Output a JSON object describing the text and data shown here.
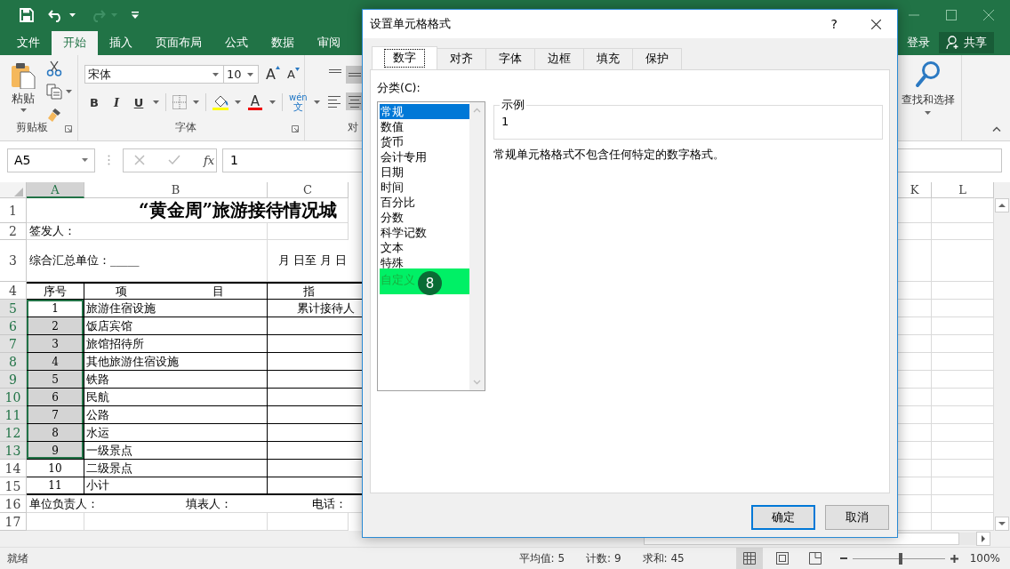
{
  "title_bar": {
    "quick_access": [
      {
        "kind": "save",
        "disabled": false
      },
      {
        "kind": "undo",
        "disabled": false
      },
      {
        "kind": "redo",
        "disabled": true
      },
      {
        "kind": "customize",
        "disabled": false
      }
    ]
  },
  "ribbon_tabs": [
    {
      "label": "文件",
      "selected": false
    },
    {
      "label": "开始",
      "selected": true
    },
    {
      "label": "插入",
      "selected": false
    },
    {
      "label": "页面布局",
      "selected": false
    },
    {
      "label": "公式",
      "selected": false
    },
    {
      "label": "数据",
      "selected": false
    },
    {
      "label": "审阅",
      "selected": false
    }
  ],
  "account": {
    "sign_in": "登录",
    "share": "共享"
  },
  "ribbon": {
    "clipboard": {
      "paste": "粘贴",
      "label": "剪贴板"
    },
    "font": {
      "name": "宋体",
      "size": "10",
      "grow": "A",
      "shrink": "A",
      "bold": "B",
      "italic": "I",
      "underline": "U",
      "font_color": "A",
      "phonetic": "wén",
      "phonetic_char": "文",
      "label": "字体"
    },
    "alignment": {
      "label": "对",
      "vertical": [
        {
          "kind": "top",
          "selected": false
        },
        {
          "kind": "middle",
          "selected": true
        }
      ],
      "horizontal": [
        {
          "kind": "left",
          "selected": false
        },
        {
          "kind": "center",
          "selected": true
        }
      ]
    },
    "editing": {
      "find_select": "查找和选择"
    }
  },
  "formula_bar": {
    "name_box": "A5",
    "function_label": "fx",
    "value": "1"
  },
  "sheet": {
    "columns": [
      {
        "label": "A",
        "selected": true
      },
      {
        "label": "B",
        "selected": false
      },
      {
        "label": "C",
        "selected": false
      },
      {
        "label": "K",
        "selected": false
      },
      {
        "label": "L",
        "selected": false
      }
    ],
    "rows": [
      {
        "number": "1",
        "kind": "title",
        "selected": false,
        "title": "“黄金周”旅游接待情况城"
      },
      {
        "number": "2",
        "kind": "plain",
        "selected": false,
        "text": "签发人："
      },
      {
        "number": "3",
        "kind": "unit",
        "selected": false,
        "text": "综合汇总单位：_____",
        "date_range": "月 日至 月 日"
      },
      {
        "number": "4",
        "kind": "header",
        "selected": false,
        "index": "序号",
        "item_left": "项",
        "item_right": "目",
        "indicator": "指"
      },
      {
        "number": "5",
        "kind": "data",
        "selected": true,
        "index": "1",
        "item": "旅游住宿设施",
        "indicator": "累计接待人"
      },
      {
        "number": "6",
        "kind": "data",
        "selected": true,
        "index": "2",
        "item": "饭店宾馆"
      },
      {
        "number": "7",
        "kind": "data",
        "selected": true,
        "index": "3",
        "item": "旅馆招待所"
      },
      {
        "number": "8",
        "kind": "data",
        "selected": true,
        "index": "4",
        "item": "其他旅游住宿设施"
      },
      {
        "number": "9",
        "kind": "data",
        "selected": true,
        "index": "5",
        "item": "铁路"
      },
      {
        "number": "10",
        "kind": "data",
        "selected": true,
        "index": "6",
        "item": "民航"
      },
      {
        "number": "11",
        "kind": "data",
        "selected": true,
        "index": "7",
        "item": "公路"
      },
      {
        "number": "12",
        "kind": "data",
        "selected": true,
        "index": "8",
        "item": "水运"
      },
      {
        "number": "13",
        "kind": "data",
        "selected": true,
        "index": "9",
        "item": "一级景点"
      },
      {
        "number": "14",
        "kind": "data",
        "selected": false,
        "index": "10",
        "item": "二级景点"
      },
      {
        "number": "15",
        "kind": "data",
        "selected": false,
        "index": "11",
        "item": "小计"
      },
      {
        "number": "16",
        "kind": "footer",
        "selected": false,
        "texts": [
          "单位负责人：",
          "填表人：",
          "电话："
        ]
      },
      {
        "number": "17",
        "kind": "blank",
        "selected": false
      }
    ]
  },
  "dialog": {
    "title": "设置单元格格式",
    "help": "?",
    "tabs": [
      {
        "label": "数字",
        "selected": true
      },
      {
        "label": "对齐",
        "selected": false
      },
      {
        "label": "字体",
        "selected": false
      },
      {
        "label": "边框",
        "selected": false
      },
      {
        "label": "填充",
        "selected": false
      },
      {
        "label": "保护",
        "selected": false
      }
    ],
    "category_label": "分类(C):",
    "categories": [
      {
        "label": "常规",
        "selected": true,
        "highlighted": false
      },
      {
        "label": "数值",
        "selected": false,
        "highlighted": false
      },
      {
        "label": "货币",
        "selected": false,
        "highlighted": false
      },
      {
        "label": "会计专用",
        "selected": false,
        "highlighted": false
      },
      {
        "label": "日期",
        "selected": false,
        "highlighted": false
      },
      {
        "label": "时间",
        "selected": false,
        "highlighted": false
      },
      {
        "label": "百分比",
        "selected": false,
        "highlighted": false
      },
      {
        "label": "分数",
        "selected": false,
        "highlighted": false
      },
      {
        "label": "科学记数",
        "selected": false,
        "highlighted": false
      },
      {
        "label": "文本",
        "selected": false,
        "highlighted": false
      },
      {
        "label": "特殊",
        "selected": false,
        "highlighted": false
      },
      {
        "label": "自定义",
        "selected": false,
        "highlighted": true
      }
    ],
    "step_badge": "8",
    "sample_label": "示例",
    "sample_value": "1",
    "description": "常规单元格格式不包含任何特定的数字格式。",
    "buttons": [
      {
        "label": "确定",
        "default": true
      },
      {
        "label": "取消",
        "default": false
      }
    ]
  },
  "status_bar": {
    "status": "就绪",
    "stats": [
      "平均值: 5",
      "计数: 9",
      "求和: 45"
    ],
    "views": [
      {
        "kind": "normal",
        "selected": true
      },
      {
        "kind": "page_layout",
        "selected": false
      },
      {
        "kind": "page_break",
        "selected": false
      }
    ],
    "zoom": {
      "level": 0.52,
      "reading": "100%"
    }
  }
}
